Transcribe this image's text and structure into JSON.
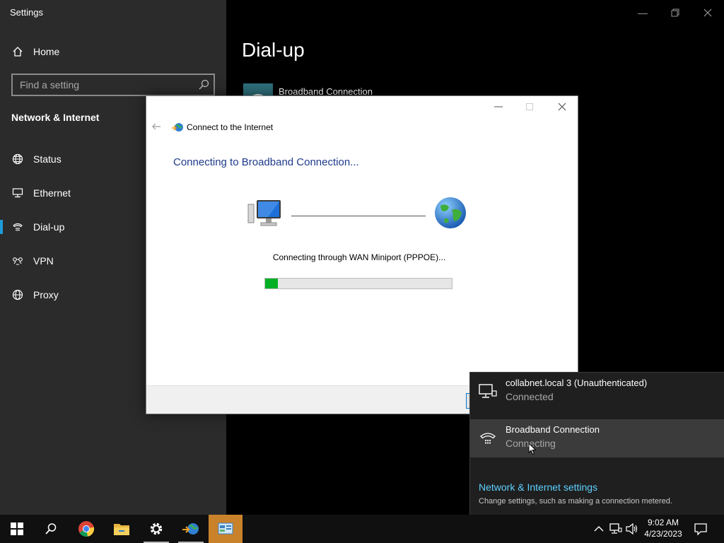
{
  "settings": {
    "window_title": "Settings",
    "home_label": "Home",
    "search_placeholder": "Find a setting",
    "section_header": "Network & Internet",
    "nav_items": [
      {
        "label": "Status",
        "icon": "globe-icon"
      },
      {
        "label": "Ethernet",
        "icon": "ethernet-icon"
      },
      {
        "label": "Dial-up",
        "icon": "dialup-icon",
        "active": true
      },
      {
        "label": "VPN",
        "icon": "vpn-icon"
      },
      {
        "label": "Proxy",
        "icon": "globe-icon"
      }
    ],
    "page_title": "Dial-up",
    "connection_label": "Broadband Connection"
  },
  "dialog": {
    "title": "Connect to the Internet",
    "heading": "Connecting to Broadband Connection...",
    "status_text": "Connecting through WAN Miniport (PPPOE)...",
    "progress_fraction": 0.07
  },
  "flyout": {
    "networks": [
      {
        "name": "collabnet.local 3 (Unauthenticated)",
        "status": "Connected",
        "icon": "ethernet-monitor-icon"
      },
      {
        "name": "Broadband Connection",
        "status": "Connecting",
        "icon": "dialup-icon"
      }
    ],
    "settings_link": "Network & Internet settings",
    "settings_sub": "Change settings, such as making a connection metered."
  },
  "taskbar": {
    "time": "9:02 AM",
    "date": "4/23/2023"
  },
  "colors": {
    "accent": "#1f9cd8",
    "link": "#5fd0ff",
    "progress": "#06b025",
    "heading_blue": "#1e3a8a",
    "active_taskbar": "#c9822a"
  }
}
